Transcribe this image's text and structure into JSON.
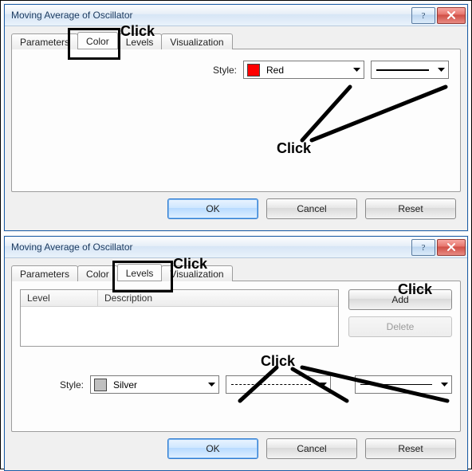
{
  "dialog1": {
    "title": "Moving Average of Oscillator",
    "tabs": [
      "Parameters",
      "Color",
      "Levels",
      "Visualization"
    ],
    "activeTab": "Color",
    "body": {
      "style_label": "Style:",
      "color_name": "Red",
      "color_hex": "#ff0000"
    },
    "buttons": {
      "ok": "OK",
      "cancel": "Cancel",
      "reset": "Reset"
    },
    "annotations": {
      "click_tab": "Click",
      "click_combo": "Click"
    }
  },
  "dialog2": {
    "title": "Moving Average of Oscillator",
    "tabs": [
      "Parameters",
      "Color",
      "Levels",
      "Visualization"
    ],
    "activeTab": "Levels",
    "body": {
      "columns": [
        "Level",
        "Description"
      ],
      "add_label": "Add",
      "delete_label": "Delete",
      "style_label": "Style:",
      "color_name": "Silver",
      "color_hex": "#c0c0c0"
    },
    "buttons": {
      "ok": "OK",
      "cancel": "Cancel",
      "reset": "Reset"
    },
    "annotations": {
      "click_tab": "Click",
      "click_add": "Click",
      "click_combo": "Click"
    }
  }
}
